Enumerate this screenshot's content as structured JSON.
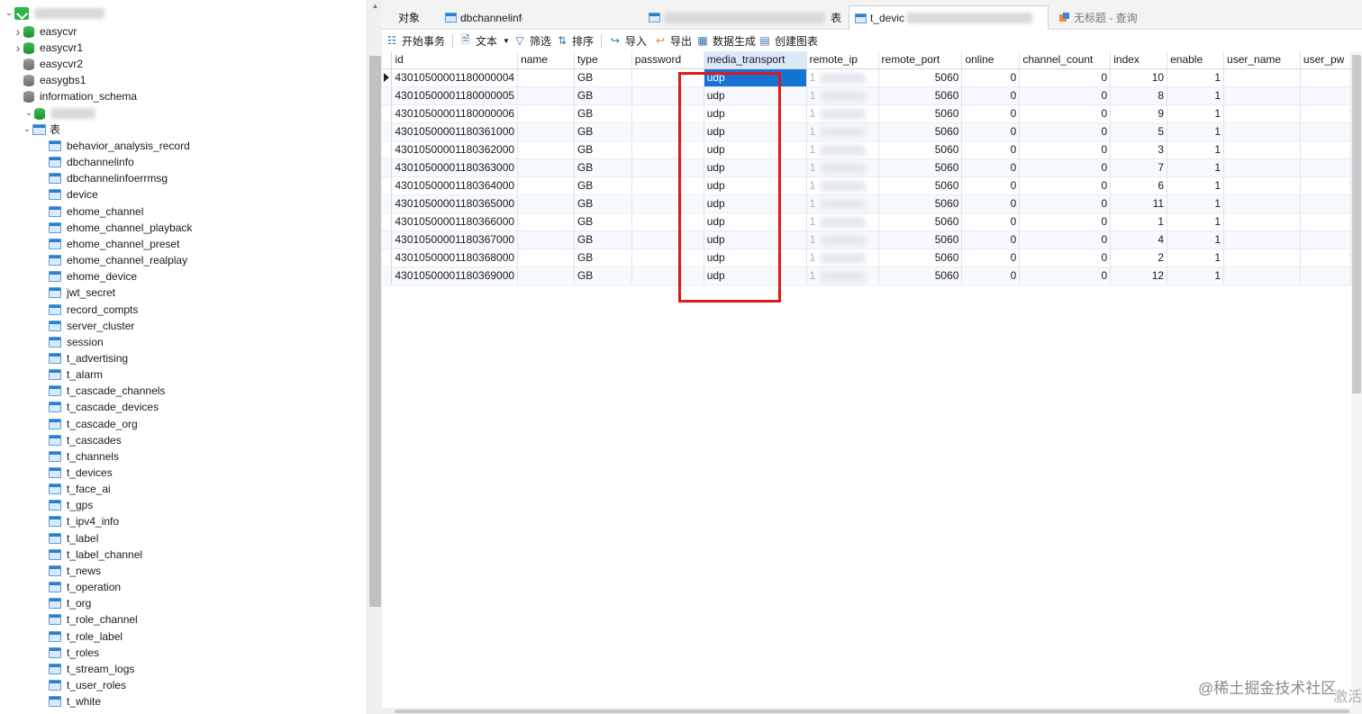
{
  "sidebar": {
    "connection": "",
    "databases": [
      "easycvr",
      "easycvr1",
      "easycvr2",
      "easygbs1",
      "information_schema"
    ],
    "current_db": "",
    "tables_folder": "表",
    "tables": [
      "behavior_analysis_record",
      "dbchannelinfo",
      "dbchannelinfoerrmsg",
      "device",
      "ehome_channel",
      "ehome_channel_playback",
      "ehome_channel_preset",
      "ehome_channel_realplay",
      "ehome_device",
      "jwt_secret",
      "record_compts",
      "server_cluster",
      "session",
      "t_advertising",
      "t_alarm",
      "t_cascade_channels",
      "t_cascade_devices",
      "t_cascade_org",
      "t_cascades",
      "t_channels",
      "t_devices",
      "t_face_ai",
      "t_gps",
      "t_ipv4_info",
      "t_label",
      "t_label_channel",
      "t_news",
      "t_operation",
      "t_org",
      "t_role_channel",
      "t_role_label",
      "t_roles",
      "t_stream_logs",
      "t_user_roles",
      "t_white"
    ]
  },
  "tabs": {
    "objects": "对象",
    "dbchannelinfo": "dbchannelinfo",
    "table_suffix": "表",
    "t_device": "t_devic",
    "untitled_query": "无标题 - 查询"
  },
  "toolbar": {
    "begin_transaction": "开始事务",
    "text": "文本",
    "filter": "筛选",
    "sort": "排序",
    "import": "导入",
    "export": "导出",
    "data_generation": "数据生成",
    "create_chart": "创建图表"
  },
  "grid": {
    "columns": [
      "id",
      "name",
      "type",
      "password",
      "media_transport",
      "remote_ip",
      "remote_port",
      "online",
      "channel_count",
      "index",
      "enable",
      "user_name",
      "user_pw"
    ],
    "rows": [
      {
        "id": "43010500001180000004",
        "name": "",
        "type": "GB",
        "password": "",
        "media_transport": "udp",
        "remote_ip": "1",
        "remote_port": "5060",
        "online": "0",
        "channel_count": "0",
        "index": "10",
        "enable": "1",
        "user_name": "",
        "user_pw": ""
      },
      {
        "id": "43010500001180000005",
        "name": "",
        "type": "GB",
        "password": "",
        "media_transport": "udp",
        "remote_ip": "1",
        "remote_port": "5060",
        "online": "0",
        "channel_count": "0",
        "index": "8",
        "enable": "1",
        "user_name": "",
        "user_pw": ""
      },
      {
        "id": "43010500001180000006",
        "name": "",
        "type": "GB",
        "password": "",
        "media_transport": "udp",
        "remote_ip": "1",
        "remote_port": "5060",
        "online": "0",
        "channel_count": "0",
        "index": "9",
        "enable": "1",
        "user_name": "",
        "user_pw": ""
      },
      {
        "id": "43010500001180361000",
        "name": "",
        "type": "GB",
        "password": "",
        "media_transport": "udp",
        "remote_ip": "1",
        "remote_port": "5060",
        "online": "0",
        "channel_count": "0",
        "index": "5",
        "enable": "1",
        "user_name": "",
        "user_pw": ""
      },
      {
        "id": "43010500001180362000",
        "name": "",
        "type": "GB",
        "password": "",
        "media_transport": "udp",
        "remote_ip": "1",
        "remote_port": "5060",
        "online": "0",
        "channel_count": "0",
        "index": "3",
        "enable": "1",
        "user_name": "",
        "user_pw": ""
      },
      {
        "id": "43010500001180363000",
        "name": "",
        "type": "GB",
        "password": "",
        "media_transport": "udp",
        "remote_ip": "1",
        "remote_port": "5060",
        "online": "0",
        "channel_count": "0",
        "index": "7",
        "enable": "1",
        "user_name": "",
        "user_pw": ""
      },
      {
        "id": "43010500001180364000",
        "name": "",
        "type": "GB",
        "password": "",
        "media_transport": "udp",
        "remote_ip": "1",
        "remote_port": "5060",
        "online": "0",
        "channel_count": "0",
        "index": "6",
        "enable": "1",
        "user_name": "",
        "user_pw": ""
      },
      {
        "id": "43010500001180365000",
        "name": "",
        "type": "GB",
        "password": "",
        "media_transport": "udp",
        "remote_ip": "1",
        "remote_port": "5060",
        "online": "0",
        "channel_count": "0",
        "index": "11",
        "enable": "1",
        "user_name": "",
        "user_pw": ""
      },
      {
        "id": "43010500001180366000",
        "name": "",
        "type": "GB",
        "password": "",
        "media_transport": "udp",
        "remote_ip": "1",
        "remote_port": "5060",
        "online": "0",
        "channel_count": "0",
        "index": "1",
        "enable": "1",
        "user_name": "",
        "user_pw": ""
      },
      {
        "id": "43010500001180367000",
        "name": "",
        "type": "GB",
        "password": "",
        "media_transport": "udp",
        "remote_ip": "1",
        "remote_port": "5060",
        "online": "0",
        "channel_count": "0",
        "index": "4",
        "enable": "1",
        "user_name": "",
        "user_pw": ""
      },
      {
        "id": "43010500001180368000",
        "name": "",
        "type": "GB",
        "password": "",
        "media_transport": "udp",
        "remote_ip": "1",
        "remote_port": "5060",
        "online": "0",
        "channel_count": "0",
        "index": "2",
        "enable": "1",
        "user_name": "",
        "user_pw": ""
      },
      {
        "id": "43010500001180369000",
        "name": "",
        "type": "GB",
        "password": "",
        "media_transport": "udp",
        "remote_ip": "1",
        "remote_port": "5060",
        "online": "0",
        "channel_count": "0",
        "index": "12",
        "enable": "1",
        "user_name": "",
        "user_pw": ""
      }
    ]
  },
  "watermark": "@稀土掘金技术社区",
  "activate_windows": "激活"
}
